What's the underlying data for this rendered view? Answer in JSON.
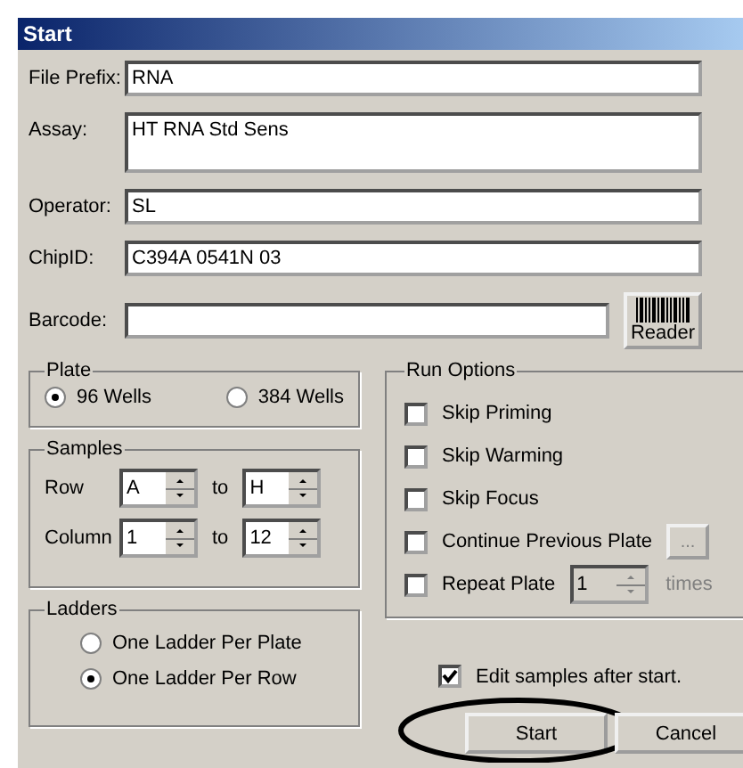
{
  "window": {
    "title": "Start"
  },
  "fields": [
    {
      "label": "File Prefix:",
      "value": "RNA",
      "kind": "line"
    },
    {
      "label": "Assay:",
      "value": "HT RNA Std Sens",
      "kind": "tall"
    },
    {
      "label": "Operator:",
      "value": "SL",
      "kind": "line"
    },
    {
      "label": "ChipID:",
      "value": "C394A 0541N 03",
      "kind": "line"
    },
    {
      "label": "Barcode:",
      "kind": "barcode",
      "button": "Reader"
    }
  ],
  "plate": {
    "title": "Plate",
    "options": [
      {
        "label": "96 Wells",
        "selected": true
      },
      {
        "label": "384 Wells",
        "selected": false
      }
    ]
  },
  "samples": {
    "title": "Samples",
    "rows": [
      {
        "label": "Row",
        "from": "A",
        "to_label": "to",
        "to": "H"
      },
      {
        "label": "Column",
        "from": "1",
        "to_label": "to",
        "to": "12"
      }
    ]
  },
  "ladders": {
    "title": "Ladders",
    "options": [
      {
        "label": "One Ladder Per Plate",
        "selected": false
      },
      {
        "label": "One Ladder Per Row",
        "selected": true
      }
    ]
  },
  "run_options": {
    "title": "Run Options",
    "items": [
      {
        "label": "Skip Priming",
        "checked": false,
        "kind": "plain"
      },
      {
        "label": "Skip Warming",
        "checked": false,
        "kind": "plain"
      },
      {
        "label": "Skip Focus",
        "checked": false,
        "kind": "plain"
      },
      {
        "label": "Continue Previous Plate",
        "checked": false,
        "kind": "browse",
        "button": "..."
      },
      {
        "label": "Repeat Plate",
        "checked": false,
        "kind": "count",
        "value": "1",
        "suffix": "times"
      }
    ]
  },
  "edit_samples": {
    "label": "Edit samples after start.",
    "checked": true
  },
  "buttons": [
    {
      "label": "Start",
      "circled": true
    },
    {
      "label": "Cancel",
      "circled": false
    }
  ]
}
